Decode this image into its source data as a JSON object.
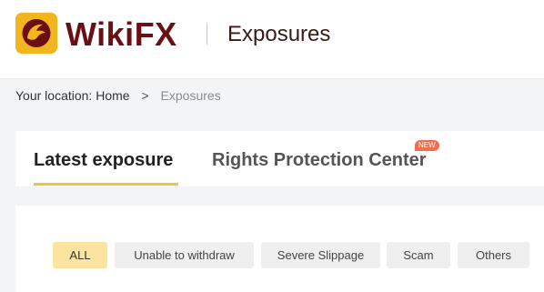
{
  "header": {
    "brand": "WikiFX",
    "title": "Exposures"
  },
  "breadcrumb": {
    "prefix": "Your location:",
    "home": "Home",
    "separator": ">",
    "current": "Exposures"
  },
  "tabs": [
    {
      "label": "Latest exposure",
      "active": true
    },
    {
      "label": "Rights Protection Center",
      "badge": "NEW",
      "active": false
    }
  ],
  "filters": [
    {
      "label": "ALL",
      "selected": true
    },
    {
      "label": "Unable to withdraw",
      "selected": false
    },
    {
      "label": "Severe Slippage",
      "selected": false
    },
    {
      "label": "Scam",
      "selected": false
    },
    {
      "label": "Others",
      "selected": false
    }
  ],
  "colors": {
    "brand": "#6a0f13",
    "logo_bg": "#f2b51d",
    "accent_underline": "#f0c43a",
    "selected_chip": "#fbe3a0",
    "new_badge": "#ef6f4c"
  },
  "icons": {
    "logo": "eagle-logo-icon"
  }
}
